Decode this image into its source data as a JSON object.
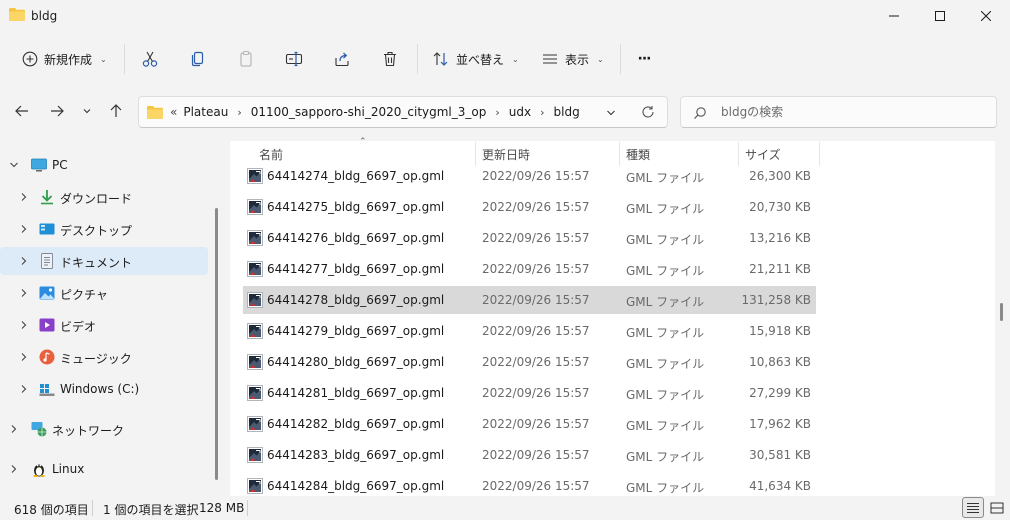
{
  "window": {
    "title": "bldg",
    "folder_icon": "folder-icon",
    "minimize_icon": "minimize-icon",
    "maximize_icon": "maximize-icon",
    "close_icon": "close-icon"
  },
  "toolbar": {
    "new_label": "新規作成",
    "sort_label": "並べ替え",
    "view_label": "表示",
    "more_label": "···",
    "icons": [
      "plus-circle-icon",
      "cut-icon",
      "copy-icon",
      "paste-icon",
      "rename-icon",
      "share-icon",
      "delete-icon",
      "sort-icon",
      "view-icon",
      "more-icon"
    ]
  },
  "address": {
    "overflow": "«",
    "crumbs": [
      "Plateau",
      "01100_sapporo-shi_2020_citygml_3_op",
      "udx",
      "bldg"
    ]
  },
  "search": {
    "placeholder": "bldgの検索"
  },
  "nav": {
    "items": [
      {
        "label": "PC",
        "icon": "pc-icon"
      },
      {
        "label": "ダウンロード",
        "icon": "download-icon"
      },
      {
        "label": "デスクトップ",
        "icon": "desktop-icon"
      },
      {
        "label": "ドキュメント",
        "icon": "document-icon"
      },
      {
        "label": "ピクチャ",
        "icon": "pictures-icon"
      },
      {
        "label": "ビデオ",
        "icon": "video-icon"
      },
      {
        "label": "ミュージック",
        "icon": "music-icon"
      },
      {
        "label": "Windows (C:)",
        "icon": "drive-icon"
      },
      {
        "label": "ネットワーク",
        "icon": "network-icon"
      },
      {
        "label": "Linux",
        "icon": "linux-icon"
      }
    ],
    "selected": "ドキュメント"
  },
  "columns": {
    "name": "名前",
    "date": "更新日時",
    "type": "種類",
    "size": "サイズ"
  },
  "files": [
    {
      "name": "64414274_bldg_6697_op.gml",
      "date": "2022/09/26 15:57",
      "type": "GML ファイル",
      "size": "26,300 KB"
    },
    {
      "name": "64414275_bldg_6697_op.gml",
      "date": "2022/09/26 15:57",
      "type": "GML ファイル",
      "size": "20,730 KB"
    },
    {
      "name": "64414276_bldg_6697_op.gml",
      "date": "2022/09/26 15:57",
      "type": "GML ファイル",
      "size": "13,216 KB"
    },
    {
      "name": "64414277_bldg_6697_op.gml",
      "date": "2022/09/26 15:57",
      "type": "GML ファイル",
      "size": "21,211 KB"
    },
    {
      "name": "64414278_bldg_6697_op.gml",
      "date": "2022/09/26 15:57",
      "type": "GML ファイル",
      "size": "131,258 KB"
    },
    {
      "name": "64414279_bldg_6697_op.gml",
      "date": "2022/09/26 15:57",
      "type": "GML ファイル",
      "size": "15,918 KB"
    },
    {
      "name": "64414280_bldg_6697_op.gml",
      "date": "2022/09/26 15:57",
      "type": "GML ファイル",
      "size": "10,863 KB"
    },
    {
      "name": "64414281_bldg_6697_op.gml",
      "date": "2022/09/26 15:57",
      "type": "GML ファイル",
      "size": "27,299 KB"
    },
    {
      "name": "64414282_bldg_6697_op.gml",
      "date": "2022/09/26 15:57",
      "type": "GML ファイル",
      "size": "17,962 KB"
    },
    {
      "name": "64414283_bldg_6697_op.gml",
      "date": "2022/09/26 15:57",
      "type": "GML ファイル",
      "size": "30,581 KB"
    },
    {
      "name": "64414284_bldg_6697_op.gml",
      "date": "2022/09/26 15:57",
      "type": "GML ファイル",
      "size": "41,634 KB"
    }
  ],
  "selected_file": "64414278_bldg_6697_op.gml",
  "status": {
    "count": "618 個の項目",
    "selection": "1 個の項目を選択",
    "size": "128 MB"
  },
  "colors": {
    "selection_row": "#d9d9d9",
    "nav_selected": "#dcebf7",
    "folder": "#f5c542"
  }
}
